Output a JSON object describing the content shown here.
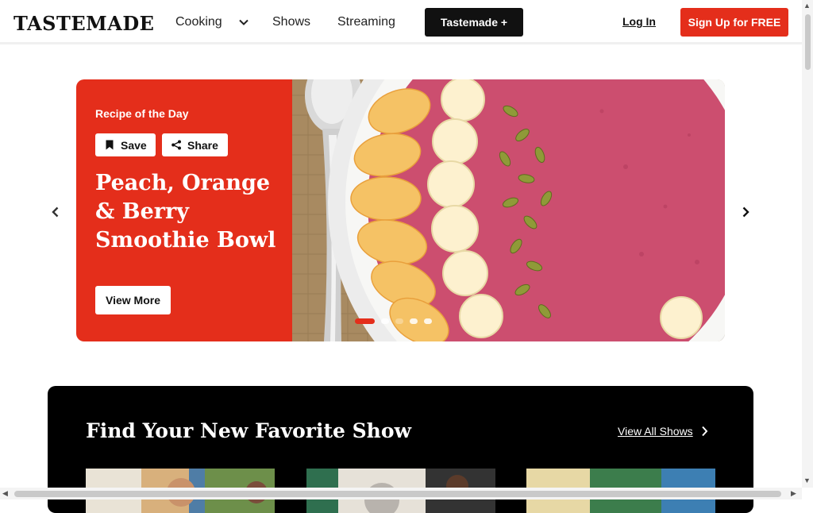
{
  "header": {
    "logo": "TASTEMADE",
    "nav": {
      "cooking": "Cooking",
      "shows": "Shows",
      "streaming": "Streaming"
    },
    "tastemade_plus": "Tastemade +",
    "login": "Log In",
    "signup": "Sign Up for FREE"
  },
  "hero": {
    "eyebrow": "Recipe of the Day",
    "save_label": "Save",
    "share_label": "Share",
    "title": "Peach, Orange & Berry Smoothie Bowl",
    "cta": "View More",
    "slide_count": 5,
    "active_slide": 1
  },
  "shows": {
    "title": "Find Your New Favorite Show",
    "view_all": "View All Shows"
  },
  "colors": {
    "brand_red": "#e42e1b",
    "black": "#000000"
  },
  "icons": [
    "chevron-down-icon",
    "chevron-left-icon",
    "chevron-right-icon",
    "bookmark-icon",
    "share-icon"
  ]
}
